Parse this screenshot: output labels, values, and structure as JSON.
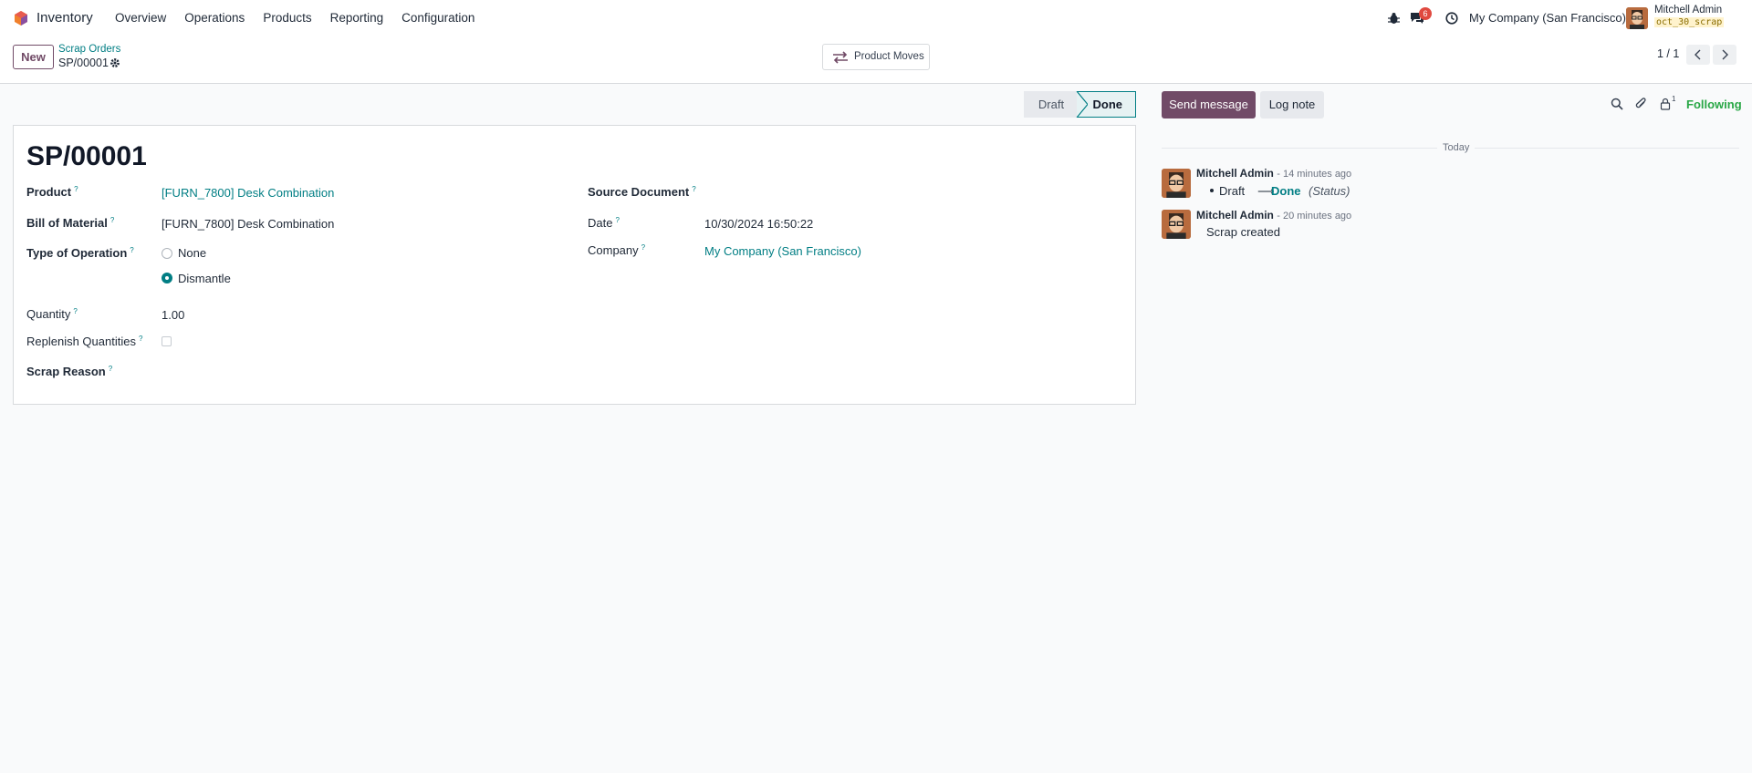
{
  "navbar": {
    "app_name": "Inventory",
    "menu": [
      "Overview",
      "Operations",
      "Products",
      "Reporting",
      "Configuration"
    ],
    "messages_badge": "6",
    "company": "My Company (San Francisco)",
    "user_name": "Mitchell Admin",
    "db_name": "oct_30_scrap"
  },
  "control": {
    "new_label": "New",
    "breadcrumb_parent": "Scrap Orders",
    "breadcrumb_current": "SP/00001",
    "product_moves_label": "Product Moves",
    "pager": "1 / 1"
  },
  "status": {
    "draft": "Draft",
    "done": "Done",
    "active": "Done"
  },
  "form": {
    "title": "SP/00001",
    "product_label": "Product",
    "product_value": "[FURN_7800] Desk Combination",
    "bom_label": "Bill of Material",
    "bom_value": "[FURN_7800] Desk Combination",
    "type_label": "Type of Operation",
    "type_options": [
      "None",
      "Dismantle"
    ],
    "type_selected": "Dismantle",
    "quantity_label": "Quantity",
    "quantity_value": "1.00",
    "replenish_label": "Replenish Quantities",
    "replenish_checked": false,
    "scrap_reason_label": "Scrap Reason",
    "source_doc_label": "Source Document",
    "date_label": "Date",
    "date_value": "10/30/2024 16:50:22",
    "company_label": "Company",
    "company_value": "My Company (San Francisco)",
    "help_mark": "?"
  },
  "chatter": {
    "send_message": "Send message",
    "log_note": "Log note",
    "followers_count": "1",
    "following": "Following",
    "day": "Today",
    "messages": [
      {
        "author": "Mitchell Admin",
        "time": "- 14 minutes ago",
        "change_from": "Draft",
        "arrow": "⟶",
        "change_to": "Done",
        "field": "(Status)"
      },
      {
        "author": "Mitchell Admin",
        "time": "- 20 minutes ago",
        "body": "Scrap created"
      }
    ]
  },
  "colors": {
    "brand": "#714b67",
    "link": "#017e84",
    "following": "#28a745",
    "badge": "#e0493f"
  },
  "icons": [
    "inventory-logo-icon",
    "bug-icon",
    "chat-icon",
    "clock-icon",
    "gear-icon",
    "transfer-icon",
    "chevron-left-icon",
    "chevron-right-icon",
    "search-icon",
    "paperclip-icon",
    "lock-icon"
  ]
}
